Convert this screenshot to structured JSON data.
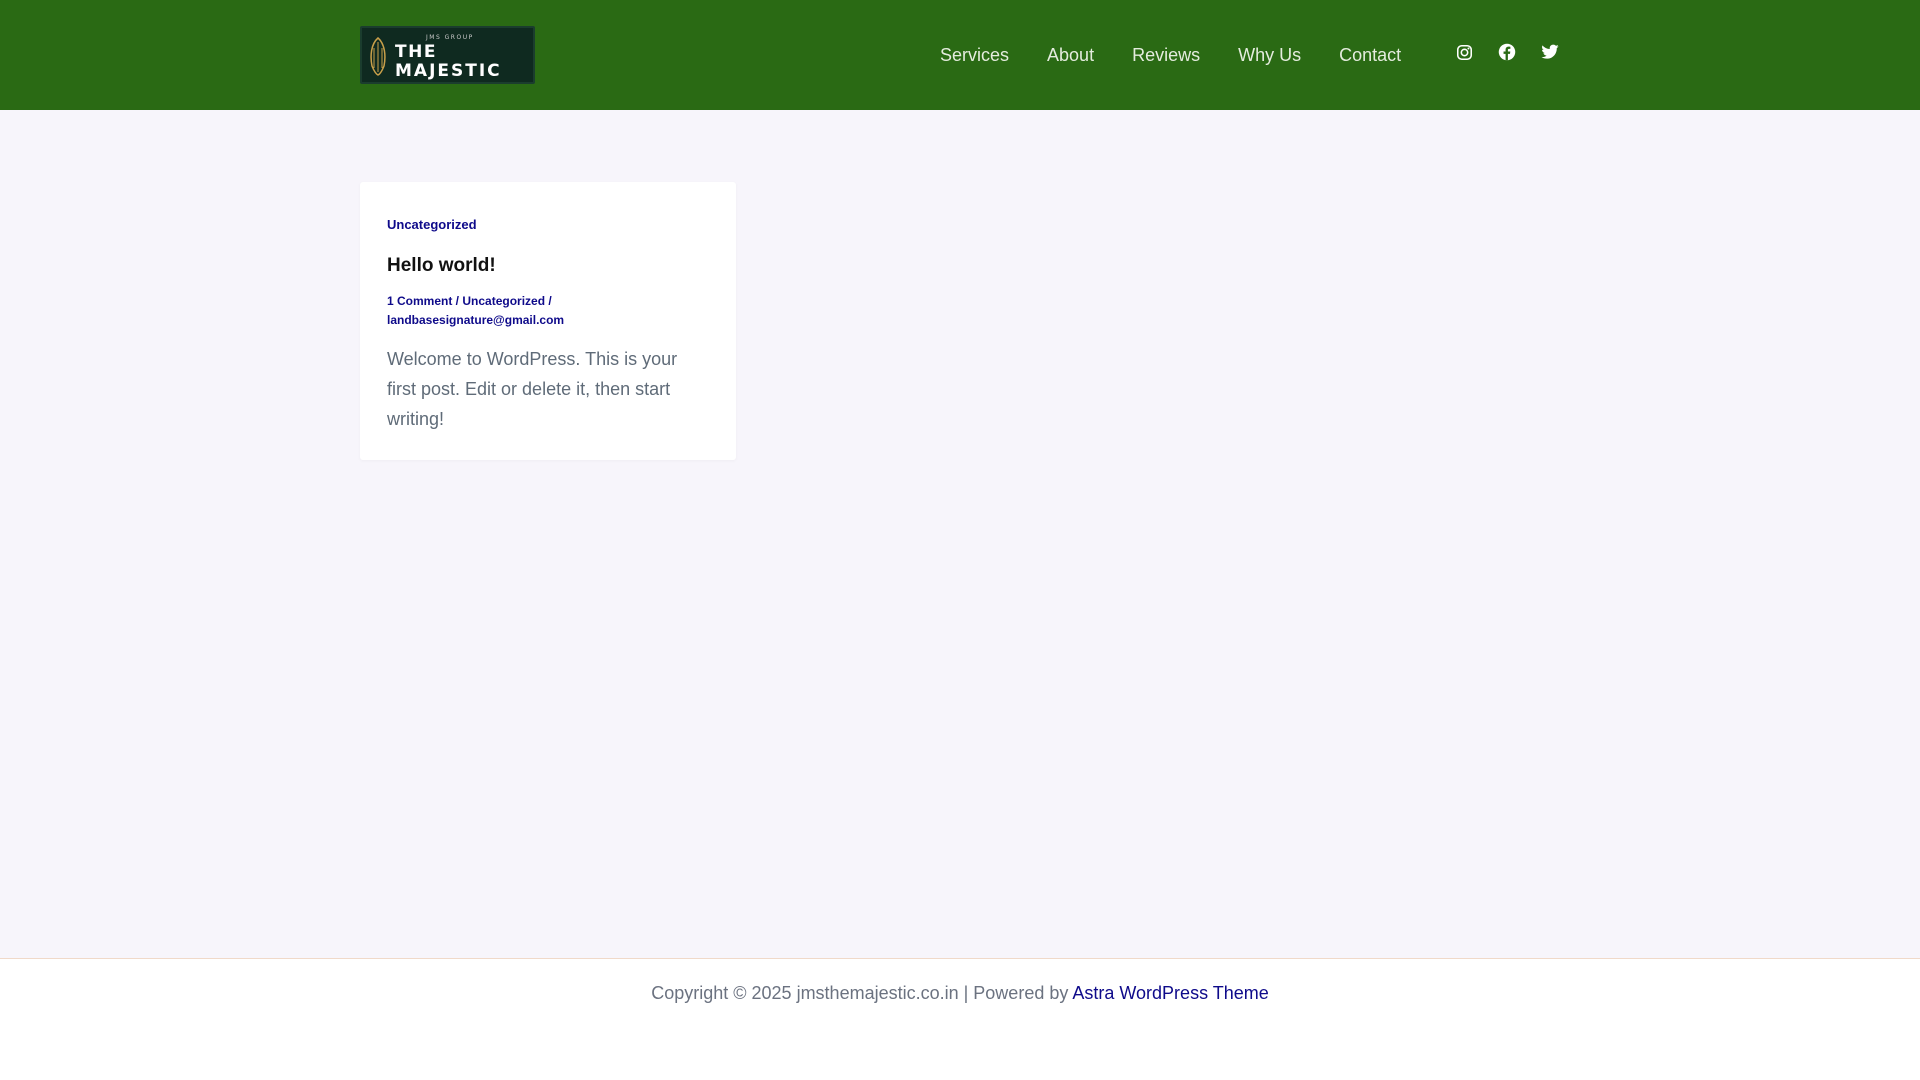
{
  "site": {
    "logo": {
      "small_text": "JMS GROUP",
      "line1": "THE",
      "line2": "MAJESTIC"
    }
  },
  "nav": {
    "items": [
      {
        "label": "Services"
      },
      {
        "label": "About"
      },
      {
        "label": "Reviews"
      },
      {
        "label": "Why Us"
      },
      {
        "label": "Contact"
      }
    ]
  },
  "social": {
    "icons": [
      "instagram-icon",
      "facebook-icon",
      "twitter-icon"
    ]
  },
  "post": {
    "category": "Uncategorized",
    "title": "Hello world!",
    "meta": {
      "comments": "1 Comment",
      "sep1": " / ",
      "category": "Uncategorized",
      "sep2": " /",
      "author": "landbasesignature@gmail.com"
    },
    "excerpt": "Welcome to WordPress. This is your first post. Edit or delete it, then start writing!"
  },
  "footer": {
    "copyright": "Copyright © 2025 jmsthemajestic.co.in | Powered by ",
    "link": "Astra WordPress Theme"
  },
  "colors": {
    "header_bg": "#2a6a14",
    "link": "#0e0a8a",
    "page_bg": "#f7f5fb"
  }
}
